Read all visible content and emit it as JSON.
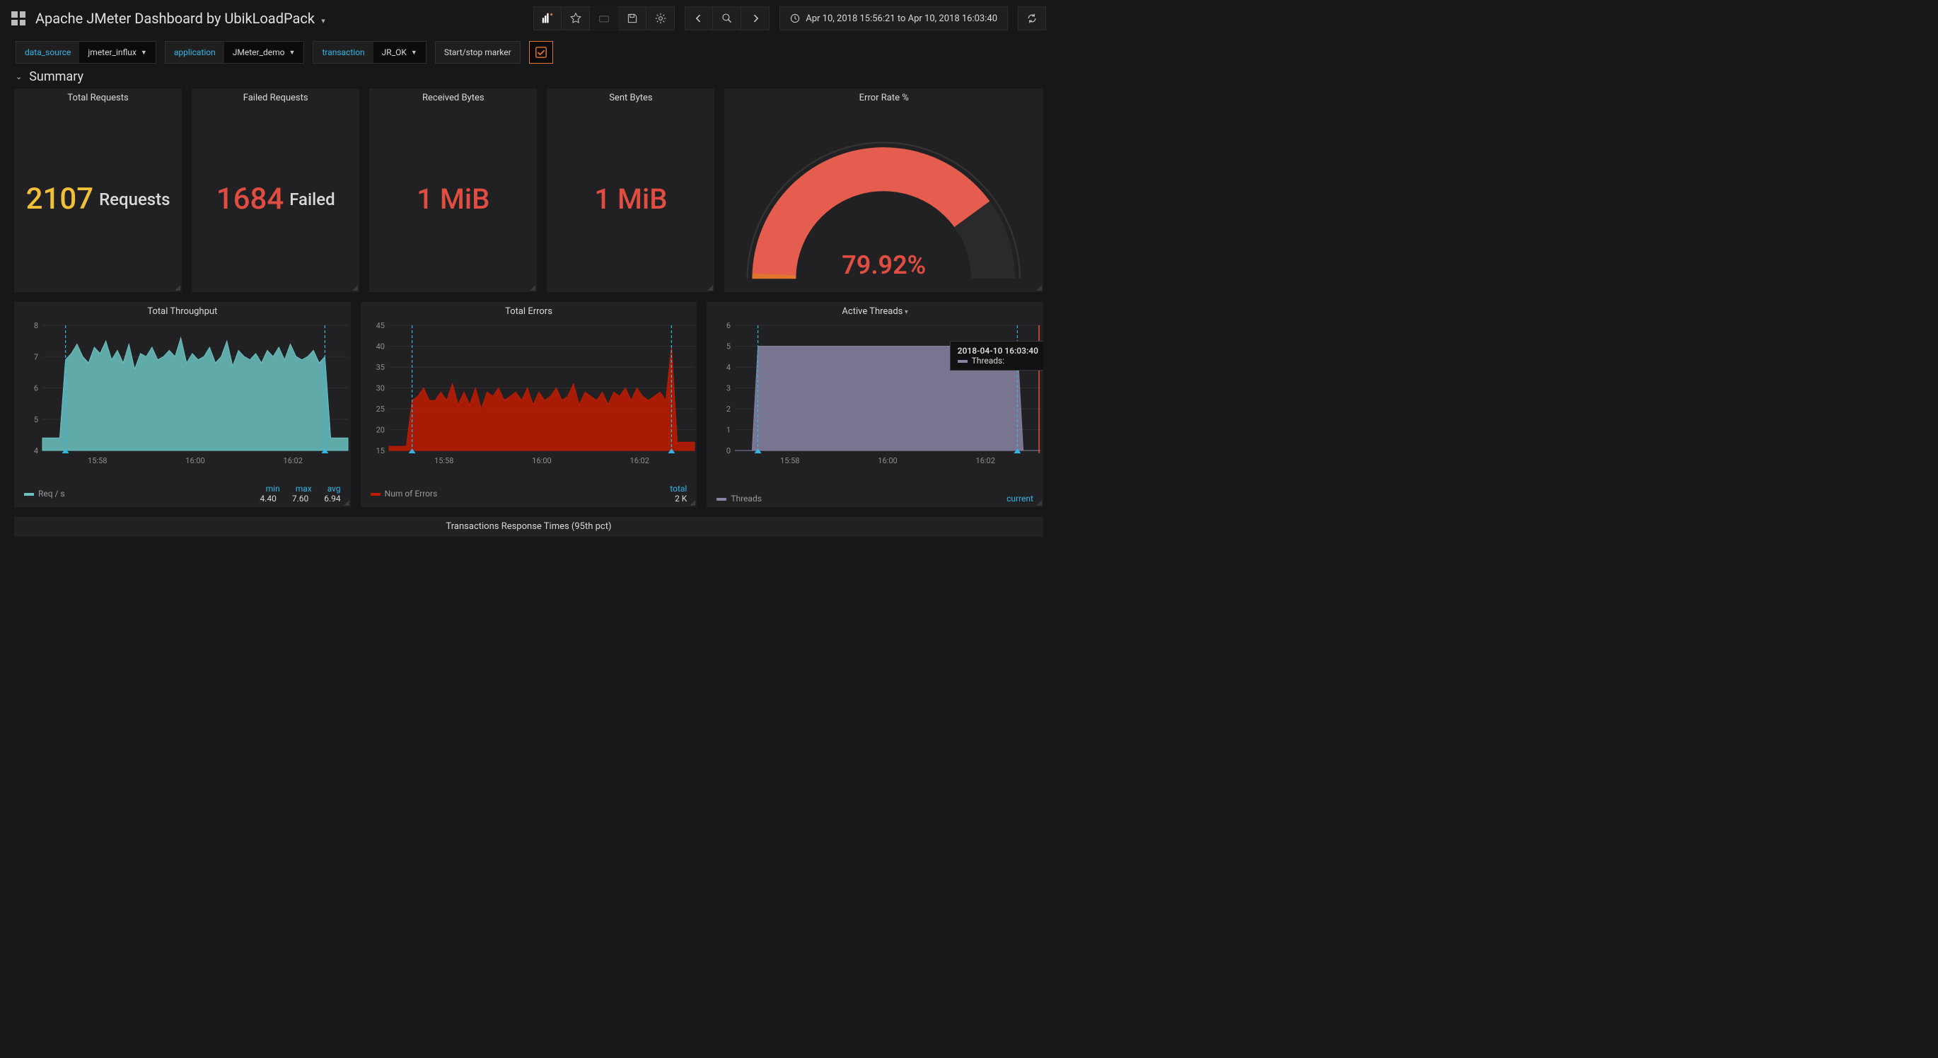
{
  "header": {
    "title": "Apache JMeter Dashboard by UbikLoadPack",
    "timerange": "Apr 10, 2018 15:56:21 to Apr 10, 2018 16:03:40"
  },
  "vars": {
    "data_source": {
      "label": "data_source",
      "value": "jmeter_influx"
    },
    "application": {
      "label": "application",
      "value": "JMeter_demo"
    },
    "transaction": {
      "label": "transaction",
      "value": "JR_OK"
    },
    "marker": {
      "label": "Start/stop marker"
    }
  },
  "section": {
    "summary": "Summary"
  },
  "singlestats": {
    "total_requests": {
      "title": "Total Requests",
      "value": "2107",
      "suffix": "Requests"
    },
    "failed_requests": {
      "title": "Failed Requests",
      "value": "1684",
      "suffix": "Failed"
    },
    "received_bytes": {
      "title": "Received Bytes",
      "value": "1 MiB"
    },
    "sent_bytes": {
      "title": "Sent Bytes",
      "value": "1 MiB"
    },
    "error_rate": {
      "title": "Error Rate %",
      "value": "79.92%"
    }
  },
  "throughput": {
    "title": "Total Throughput",
    "legend": "Req / s",
    "stats_hdr": {
      "min": "min",
      "max": "max",
      "avg": "avg"
    },
    "stats_val": {
      "min": "4.40",
      "max": "7.60",
      "avg": "6.94"
    }
  },
  "errors": {
    "title": "Total Errors",
    "legend": "Num of Errors",
    "stats_hdr": {
      "total": "total"
    },
    "stats_val": {
      "total": "2 K"
    }
  },
  "threads": {
    "title": "Active Threads",
    "legend": "Threads",
    "stats_hdr": {
      "current": "current"
    },
    "tooltip_time": "2018-04-10 16:03:40",
    "tooltip_series": "Threads:"
  },
  "row3": {
    "title": "Transactions Response Times (95th pct)"
  },
  "chart_data": [
    {
      "type": "area",
      "title": "Total Throughput",
      "ylabel": "",
      "ylim": [
        4.0,
        8.0
      ],
      "x_ticks": [
        "15:58",
        "16:00",
        "16:02"
      ],
      "annotation_x_idx": [
        4,
        49
      ],
      "series": [
        {
          "name": "Req / s",
          "stats": {
            "min": 4.4,
            "max": 7.6,
            "avg": 6.94
          },
          "color": "#6cc2c2",
          "values": [
            4.4,
            4.4,
            4.4,
            4.4,
            6.9,
            7.1,
            7.4,
            7.0,
            6.8,
            7.3,
            7.1,
            7.5,
            6.9,
            7.2,
            6.8,
            7.4,
            6.6,
            7.1,
            7.0,
            7.3,
            6.9,
            7.0,
            7.2,
            7.0,
            7.6,
            6.8,
            7.1,
            6.9,
            7.0,
            7.3,
            6.8,
            7.0,
            7.5,
            6.7,
            7.2,
            7.0,
            6.9,
            7.1,
            6.8,
            7.2,
            7.0,
            7.3,
            6.9,
            7.4,
            7.0,
            6.9,
            7.0,
            7.2,
            6.8,
            7.0,
            4.4,
            4.4,
            4.4,
            4.4
          ]
        }
      ]
    },
    {
      "type": "area",
      "title": "Total Errors",
      "ylabel": "",
      "ylim": [
        15,
        45
      ],
      "x_ticks": [
        "15:58",
        "16:00",
        "16:02"
      ],
      "annotation_x_idx": [
        4,
        49
      ],
      "series": [
        {
          "name": "Num of Errors",
          "stats": {
            "total": 2000
          },
          "color": "#bf1b00",
          "values": [
            16,
            16,
            16,
            16,
            27,
            28,
            30,
            27,
            27,
            29,
            27,
            31,
            26,
            29,
            26,
            30,
            25,
            29,
            28,
            30,
            27,
            28,
            29,
            27,
            30,
            26,
            29,
            27,
            28,
            30,
            27,
            28,
            31,
            26,
            29,
            28,
            27,
            29,
            26,
            29,
            28,
            30,
            27,
            30,
            28,
            27,
            28,
            29,
            27,
            40,
            17,
            17,
            17,
            17
          ]
        }
      ]
    },
    {
      "type": "area",
      "title": "Active Threads",
      "ylabel": "",
      "ylim": [
        0,
        6
      ],
      "x_ticks": [
        "15:58",
        "16:00",
        "16:02"
      ],
      "annotation_x_idx": [
        4,
        49
      ],
      "series": [
        {
          "name": "Threads",
          "color": "#8884a4",
          "values": [
            0,
            0,
            0,
            0,
            5,
            5,
            5,
            5,
            5,
            5,
            5,
            5,
            5,
            5,
            5,
            5,
            5,
            5,
            5,
            5,
            5,
            5,
            5,
            5,
            5,
            5,
            5,
            5,
            5,
            5,
            5,
            5,
            5,
            5,
            5,
            5,
            5,
            5,
            5,
            5,
            5,
            5,
            5,
            5,
            5,
            5,
            5,
            5,
            5,
            5,
            0,
            0,
            0,
            0
          ]
        }
      ]
    }
  ]
}
